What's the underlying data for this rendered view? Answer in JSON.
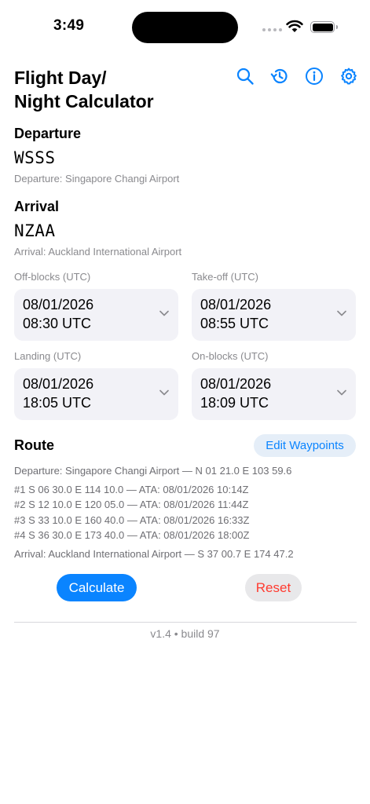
{
  "status_bar": {
    "time": "3:49"
  },
  "header": {
    "title_line1": "Flight Day/",
    "title_line2": "Night Calculator",
    "icons": [
      "search-icon",
      "history-icon",
      "info-icon",
      "settings-icon"
    ],
    "accent": "#0a84ff"
  },
  "departure": {
    "label": "Departure",
    "code": "WSSS",
    "caption": "Departure: Singapore Changi Airport"
  },
  "arrival": {
    "label": "Arrival",
    "code": "NZAA",
    "caption": "Arrival: Auckland International Airport"
  },
  "times": {
    "off_blocks": {
      "label": "Off-blocks (UTC)",
      "date": "08/01/2026",
      "time": "08:30 UTC"
    },
    "take_off": {
      "label": "Take-off (UTC)",
      "date": "08/01/2026",
      "time": "08:55 UTC"
    },
    "landing": {
      "label": "Landing (UTC)",
      "date": "08/01/2026",
      "time": "18:05 UTC"
    },
    "on_blocks": {
      "label": "On-blocks (UTC)",
      "date": "08/01/2026",
      "time": "18:09 UTC"
    }
  },
  "route": {
    "title": "Route",
    "edit_label": "Edit Waypoints",
    "departure_line": "Departure: Singapore Changi Airport — N 01 21.0 E 103 59.6",
    "waypoints": [
      "#1  S 06 30.0 E 114 10.0 — ATA: 08/01/2026 10:14Z",
      "#2  S 12 10.0 E 120 05.0 — ATA: 08/01/2026 11:44Z",
      "#3  S 33 10.0 E 160 40.0 — ATA: 08/01/2026 16:33Z",
      "#4  S 36 30.0 E 173 40.0 — ATA: 08/01/2026 18:00Z"
    ],
    "arrival_line": "Arrival: Auckland International Airport — S 37 00.7 E 174 47.2"
  },
  "actions": {
    "calculate_label": "Calculate",
    "reset_label": "Reset"
  },
  "footer": {
    "version": "v1.4 • build 97"
  }
}
